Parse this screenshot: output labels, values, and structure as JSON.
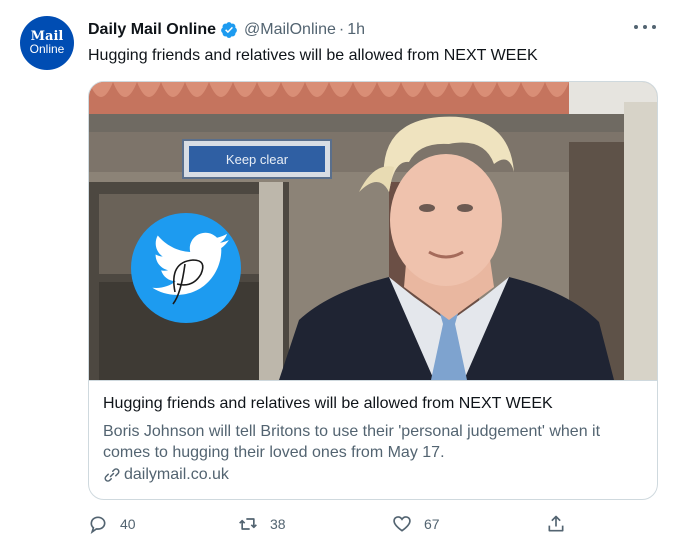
{
  "tweet": {
    "avatar": {
      "line1": "Mail",
      "line2": "Online"
    },
    "author_name": "Daily Mail Online",
    "handle": "@MailOnline",
    "separator": "·",
    "time": "1h",
    "text": "Hugging friends and relatives will be allowed from NEXT WEEK"
  },
  "card": {
    "image_sign_text": "Keep clear",
    "title": "Hugging friends and relatives will be allowed from NEXT WEEK",
    "description": "Boris Johnson will tell Britons to use their 'personal judgement' when it comes to hugging their loved ones from May 17.",
    "domain": "dailymail.co.uk"
  },
  "actions": {
    "replies": "40",
    "retweets": "38",
    "likes": "67"
  },
  "icons": {
    "verified": "verified-badge-icon",
    "more": "more-options-icon",
    "link": "link-icon",
    "reply": "reply-icon",
    "retweet": "retweet-icon",
    "like": "heart-icon",
    "share": "share-icon",
    "watermark": "twitter-bird-watermark-icon"
  },
  "colors": {
    "text_primary": "#0f1419",
    "text_secondary": "#536471",
    "verified_blue": "#1d9bf0",
    "border": "#cfd9de",
    "avatar_bg": "#004db3"
  }
}
